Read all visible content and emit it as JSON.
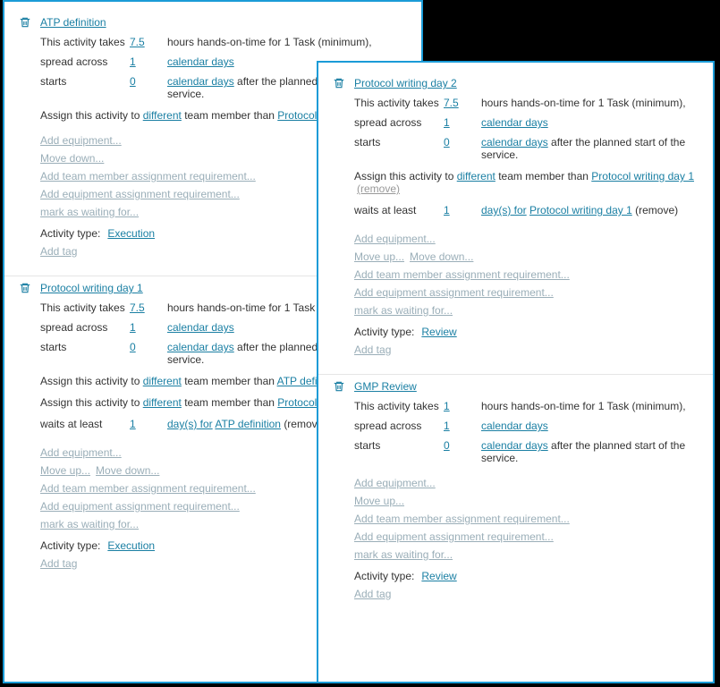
{
  "labels": {
    "takes": "This activity takes",
    "spread": "spread across",
    "starts": "starts",
    "waits": "waits",
    "dayfor": "day(s) for",
    "assign_prefix": "Assign this activity to",
    "assign_different": "different",
    "assign_middle": "team member than",
    "remove": "(remove)",
    "calendar_days": "calendar days",
    "after_planned": "after the planned start of the service.",
    "at_least": "at least",
    "activity_type": "Activity type:",
    "add_equipment": "Add equipment...",
    "move_down": "Move down...",
    "move_up": "Move up...",
    "add_team_req": "Add team member assignment requirement...",
    "add_equip_req": "Add equipment assignment requirement...",
    "mark_waiting": "mark as waiting for...",
    "add_tag": "Add tag",
    "hours_hands_on": "hours hands-on-time for 1 Task (minimum),"
  },
  "left": {
    "cards": [
      {
        "title": "ATP definition",
        "takes": "7.5",
        "spread": "1",
        "starts": "0",
        "assigns": [
          {
            "target": "Protocol writing d",
            "truncated": true,
            "remove": false
          }
        ],
        "waits": [],
        "moves": [
          "down"
        ],
        "type": "Execution"
      },
      {
        "title": "Protocol writing day 1",
        "takes": "7.5",
        "spread": "1",
        "starts": "0",
        "assigns": [
          {
            "target": "ATP definition",
            "truncated": true,
            "remove": true,
            "remove_trunc": true
          },
          {
            "target": "Protocol writing d",
            "truncated": true,
            "remove": false
          }
        ],
        "waits": [
          {
            "n": "1",
            "target": "ATP definition",
            "remove": true
          }
        ],
        "moves": [
          "up",
          "down"
        ],
        "type": "Execution"
      }
    ]
  },
  "right": {
    "cards": [
      {
        "title": "Protocol writing day 2",
        "takes": "7.5",
        "spread": "1",
        "starts": "0",
        "assigns": [
          {
            "target": "Protocol writing day 1",
            "remove": true
          }
        ],
        "waits": [
          {
            "n": "1",
            "target": "Protocol writing day 1",
            "remove": true
          }
        ],
        "moves": [
          "up",
          "down"
        ],
        "type": "Review"
      },
      {
        "title": "GMP Review",
        "takes": "1",
        "spread": "1",
        "starts": "0",
        "assigns": [],
        "waits": [],
        "moves": [
          "up"
        ],
        "type": "Review"
      }
    ]
  }
}
